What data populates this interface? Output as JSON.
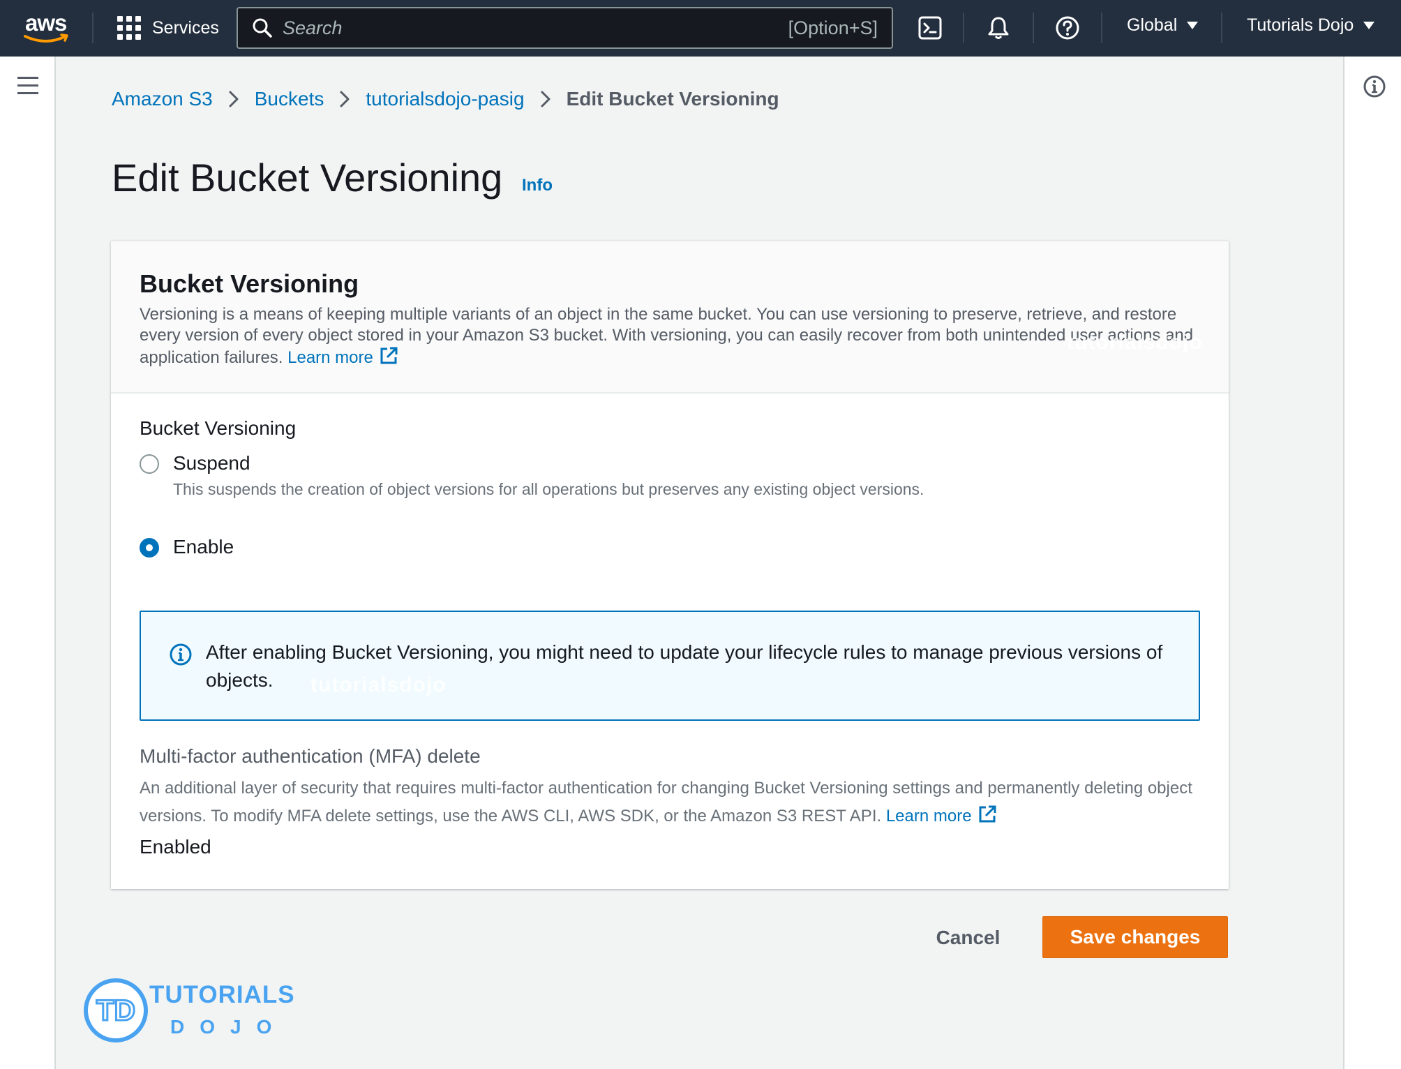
{
  "nav": {
    "logo": "aws",
    "services_label": "Services",
    "search_placeholder": "Search",
    "search_shortcut": "[Option+S]",
    "region_label": "Global",
    "account_label": "Tutorials Dojo"
  },
  "breadcrumb": {
    "items": [
      "Amazon S3",
      "Buckets",
      "tutorialsdojo-pasig"
    ],
    "current": "Edit Bucket Versioning"
  },
  "page": {
    "title": "Edit Bucket Versioning",
    "info_link": "Info"
  },
  "card": {
    "heading": "Bucket Versioning",
    "description": "Versioning is a means of keeping multiple variants of an object in the same bucket. You can use versioning to preserve, retrieve, and restore every version of every object stored in your Amazon S3 bucket. With versioning, you can easily recover from both unintended user actions and application failures.",
    "learn_more": "Learn more",
    "field_label": "Bucket Versioning",
    "options": [
      {
        "label": "Suspend",
        "description": "This suspends the creation of object versions for all operations but preserves any existing object versions.",
        "checked": false
      },
      {
        "label": "Enable",
        "checked": true
      }
    ],
    "alert": "After enabling Bucket Versioning, you might need to update your lifecycle rules to manage previous versions of objects.",
    "mfa_title": "Multi-factor authentication (MFA) delete",
    "mfa_description": "An additional layer of security that requires multi-factor authentication for changing Bucket Versioning settings and permanently deleting object versions. To modify MFA delete settings, use the AWS CLI, AWS SDK, or the Amazon S3 REST API.",
    "mfa_learn_more": "Learn more",
    "mfa_value": "Enabled",
    "watermark": "tutorialsdojo"
  },
  "actions": {
    "cancel": "Cancel",
    "save": "Save changes"
  },
  "branding": {
    "logo_mark": "TD",
    "line1": "TUTORIALS",
    "line2": "DOJO"
  },
  "colors": {
    "nav_bg": "#232f3e",
    "link": "#0073bb",
    "primary_button": "#ec7211",
    "alert_bg": "#f1faff"
  }
}
